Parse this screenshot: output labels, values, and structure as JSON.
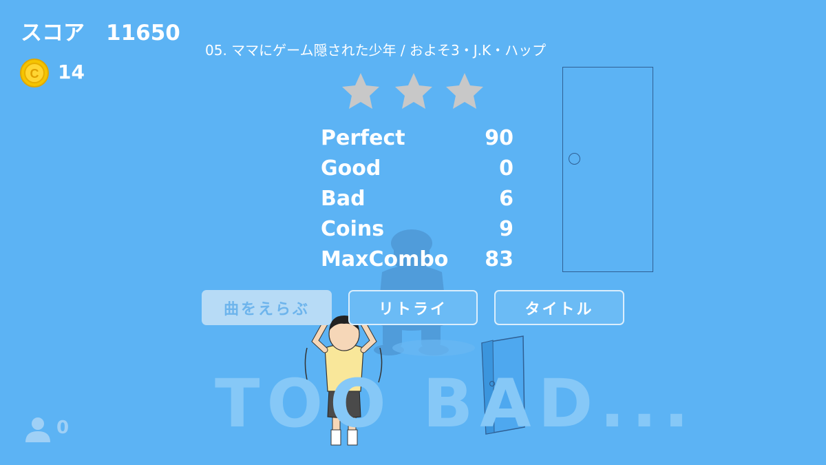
{
  "hud": {
    "score_label": "スコア　11650",
    "coin_count": "14",
    "player_count": "0"
  },
  "song": {
    "title": "05. ママにゲーム隠された少年 / およそ3・J.K・ハップ"
  },
  "rating": {
    "stars_earned": 0,
    "stars_total": 3
  },
  "results": [
    {
      "label": "Perfect",
      "value": "90"
    },
    {
      "label": "Good",
      "value": "0"
    },
    {
      "label": "Bad",
      "value": "6"
    },
    {
      "label": "Coins",
      "value": "9"
    },
    {
      "label": "MaxCombo",
      "value": "83"
    }
  ],
  "buttons": {
    "select_song": "曲をえらぶ",
    "retry": "リトライ",
    "title": "タイトル"
  },
  "banner": {
    "text": "TOO BAD..."
  },
  "icons": {
    "coin": "coin-icon",
    "star": "star-icon",
    "user": "user-icon"
  },
  "colors": {
    "background": "#5cb3f4",
    "star_empty": "#c8c8c8",
    "coin": "#f5c400"
  }
}
